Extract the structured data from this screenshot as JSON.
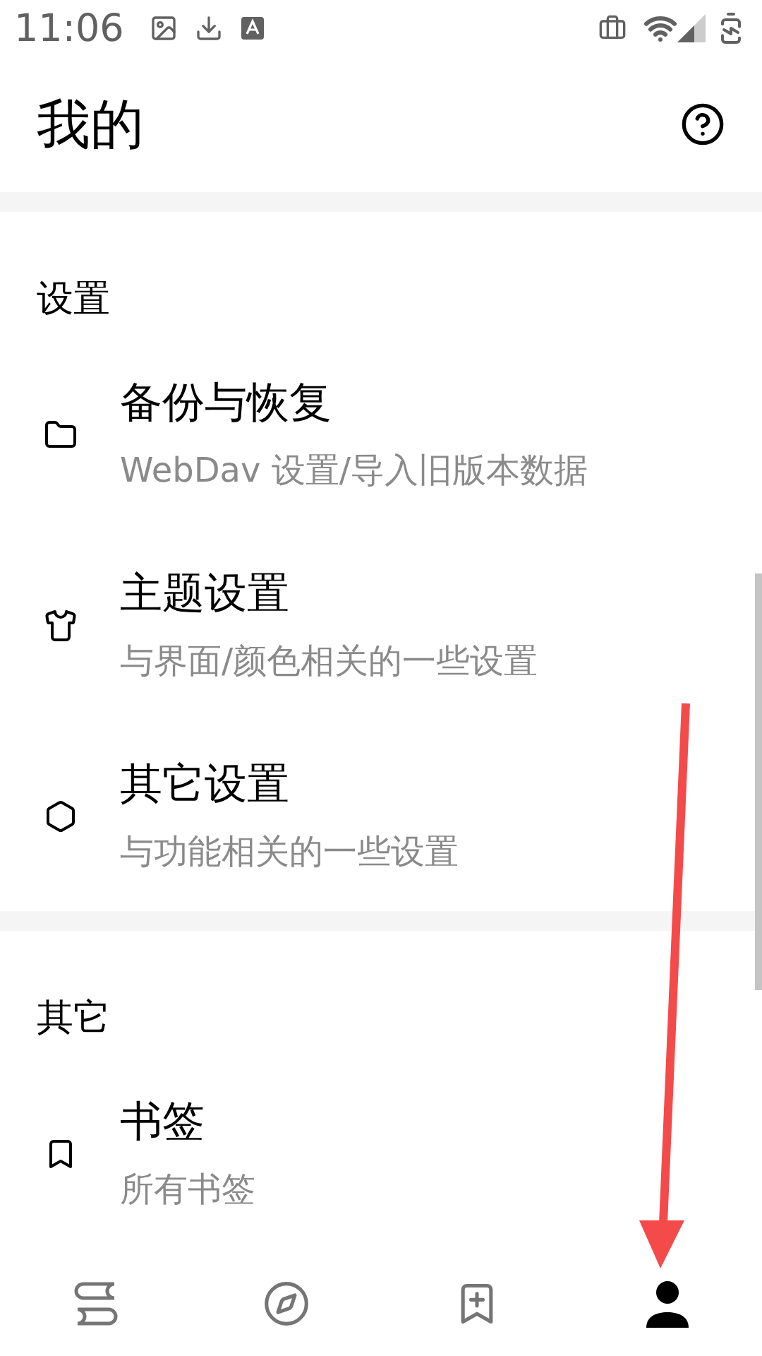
{
  "status_bar": {
    "time": "11:06"
  },
  "header": {
    "title": "我的"
  },
  "sections": [
    {
      "title": "设置",
      "items": [
        {
          "kind": "folder",
          "title": "备份与恢复",
          "subtitle": "WebDav 设置/导入旧版本数据"
        },
        {
          "kind": "shirt",
          "title": "主题设置",
          "subtitle": "与界面/颜色相关的一些设置"
        },
        {
          "kind": "hexagon",
          "title": "其它设置",
          "subtitle": "与功能相关的一些设置"
        }
      ]
    },
    {
      "title": "其它",
      "items": [
        {
          "kind": "bookmark",
          "title": "书签",
          "subtitle": "所有书签"
        }
      ]
    }
  ],
  "bottom_nav": [
    {
      "kind": "books",
      "selected": false
    },
    {
      "kind": "compass",
      "selected": false
    },
    {
      "kind": "bookmark-plus",
      "selected": false
    },
    {
      "kind": "person",
      "selected": true
    }
  ]
}
